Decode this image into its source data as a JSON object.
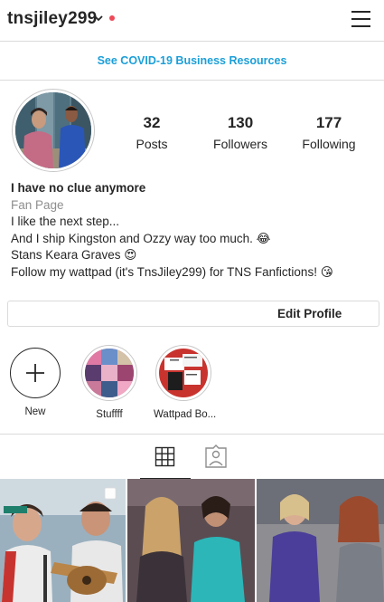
{
  "header": {
    "username": "tnsjiley299",
    "icons": [
      "chevron-down-icon",
      "notification-dot",
      "hamburger-menu-icon"
    ],
    "notification_color": "#ed4956"
  },
  "banner": {
    "text": "See COVID-19 Business Resources",
    "color": "#1c9fd8"
  },
  "stats": {
    "posts": {
      "value": "32",
      "label": "Posts"
    },
    "followers": {
      "value": "130",
      "label": "Followers"
    },
    "following": {
      "value": "177",
      "label": "Following"
    }
  },
  "bio": {
    "name": "I have no clue anymore",
    "category": "Fan Page",
    "lines": [
      "I like the next step...",
      "And I ship Kingston and Ozzy way too much. 😂",
      "Stans Keara Graves 😍",
      "Follow my wattpad (it's TnsJiley299) for TNS Fanfictions! 😘"
    ]
  },
  "edit_profile_label": "Edit Profile",
  "highlights": [
    {
      "label": "New",
      "icon": "plus-icon"
    },
    {
      "label": "Stuffff"
    },
    {
      "label": "Wattpad Bo..."
    }
  ],
  "tabs": [
    {
      "name": "grid",
      "icon": "grid-icon",
      "active": true
    },
    {
      "name": "tagged",
      "icon": "tagged-person-icon",
      "active": false
    }
  ],
  "posts_grid": {
    "visible_count": 3,
    "first_post_badge": "multi-photo-icon"
  }
}
